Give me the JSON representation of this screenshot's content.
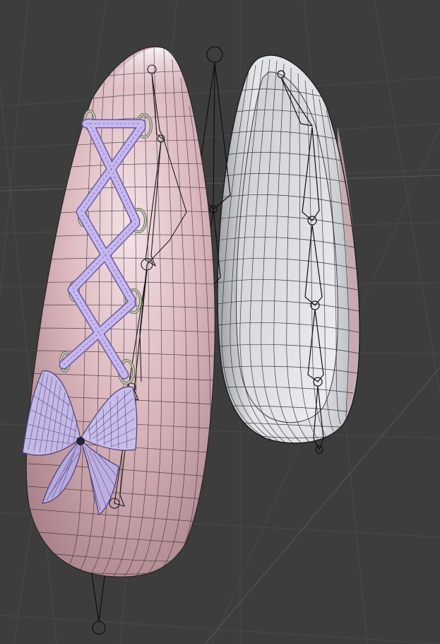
{
  "viewport": {
    "background": "#3d3d3d",
    "grid_color": "#4a4a4a",
    "grid_color_strong": "#555555"
  },
  "objects": [
    {
      "name": "left-ear",
      "material": "pink-skin",
      "color": "#d9b7bd",
      "wireframe_color": "#2b2326",
      "has_laces": true,
      "has_bow": true,
      "eyelet_count": 8
    },
    {
      "name": "right-ear",
      "material": "white-fur-inner",
      "color": "#dfe2e6",
      "wireframe_color": "#1e2023",
      "has_laces": false,
      "has_bow": false
    }
  ],
  "laces": {
    "color": "#b9a9e6",
    "stroke_color": "#6a5aa0"
  },
  "bow": {
    "color": "#c8bde8",
    "line_color": "#4b3d7a"
  },
  "armature": {
    "color": "#101010"
  }
}
